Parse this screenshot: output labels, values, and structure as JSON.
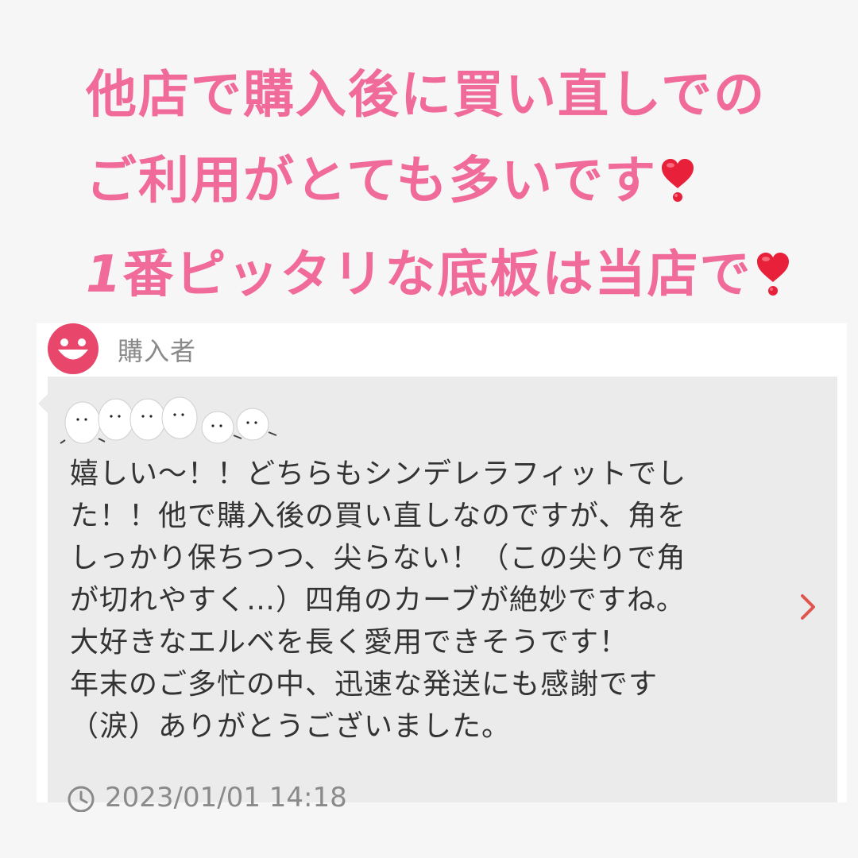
{
  "headline": {
    "line1": "他店で購入後に買い直しでの",
    "line2": "ご利用がとても多いです",
    "line3_num": "1",
    "line3": "番ピッタリな底板は当店で",
    "heart_icon": "heart-exclamation-icon",
    "color": "#f06a9a"
  },
  "review": {
    "buyer_label": "購入者",
    "avatar_icon": "smiley-avatar-icon",
    "avatar_color": "#e8476b",
    "decoration_icon": "owl-stamps-icon",
    "lines": [
      "嬉しい〜！！どちらもシンデレラフィットでし",
      "た！！他で購入後の買い直しなのですが、角を",
      "しっかり保ちつつ、尖らない！（この尖りで角",
      "が切れやすく…）四角のカーブが絶妙ですね。",
      "大好きなエルベを長く愛用できそうです！",
      "年末のご多忙の中、迅速な発送にも感謝です",
      "（涙）ありがとうございました。"
    ],
    "date": "2023/01/01 14:18",
    "date_icon": "clock-icon",
    "chevron_icon": "chevron-right-icon",
    "chevron_color": "#e0554f"
  }
}
